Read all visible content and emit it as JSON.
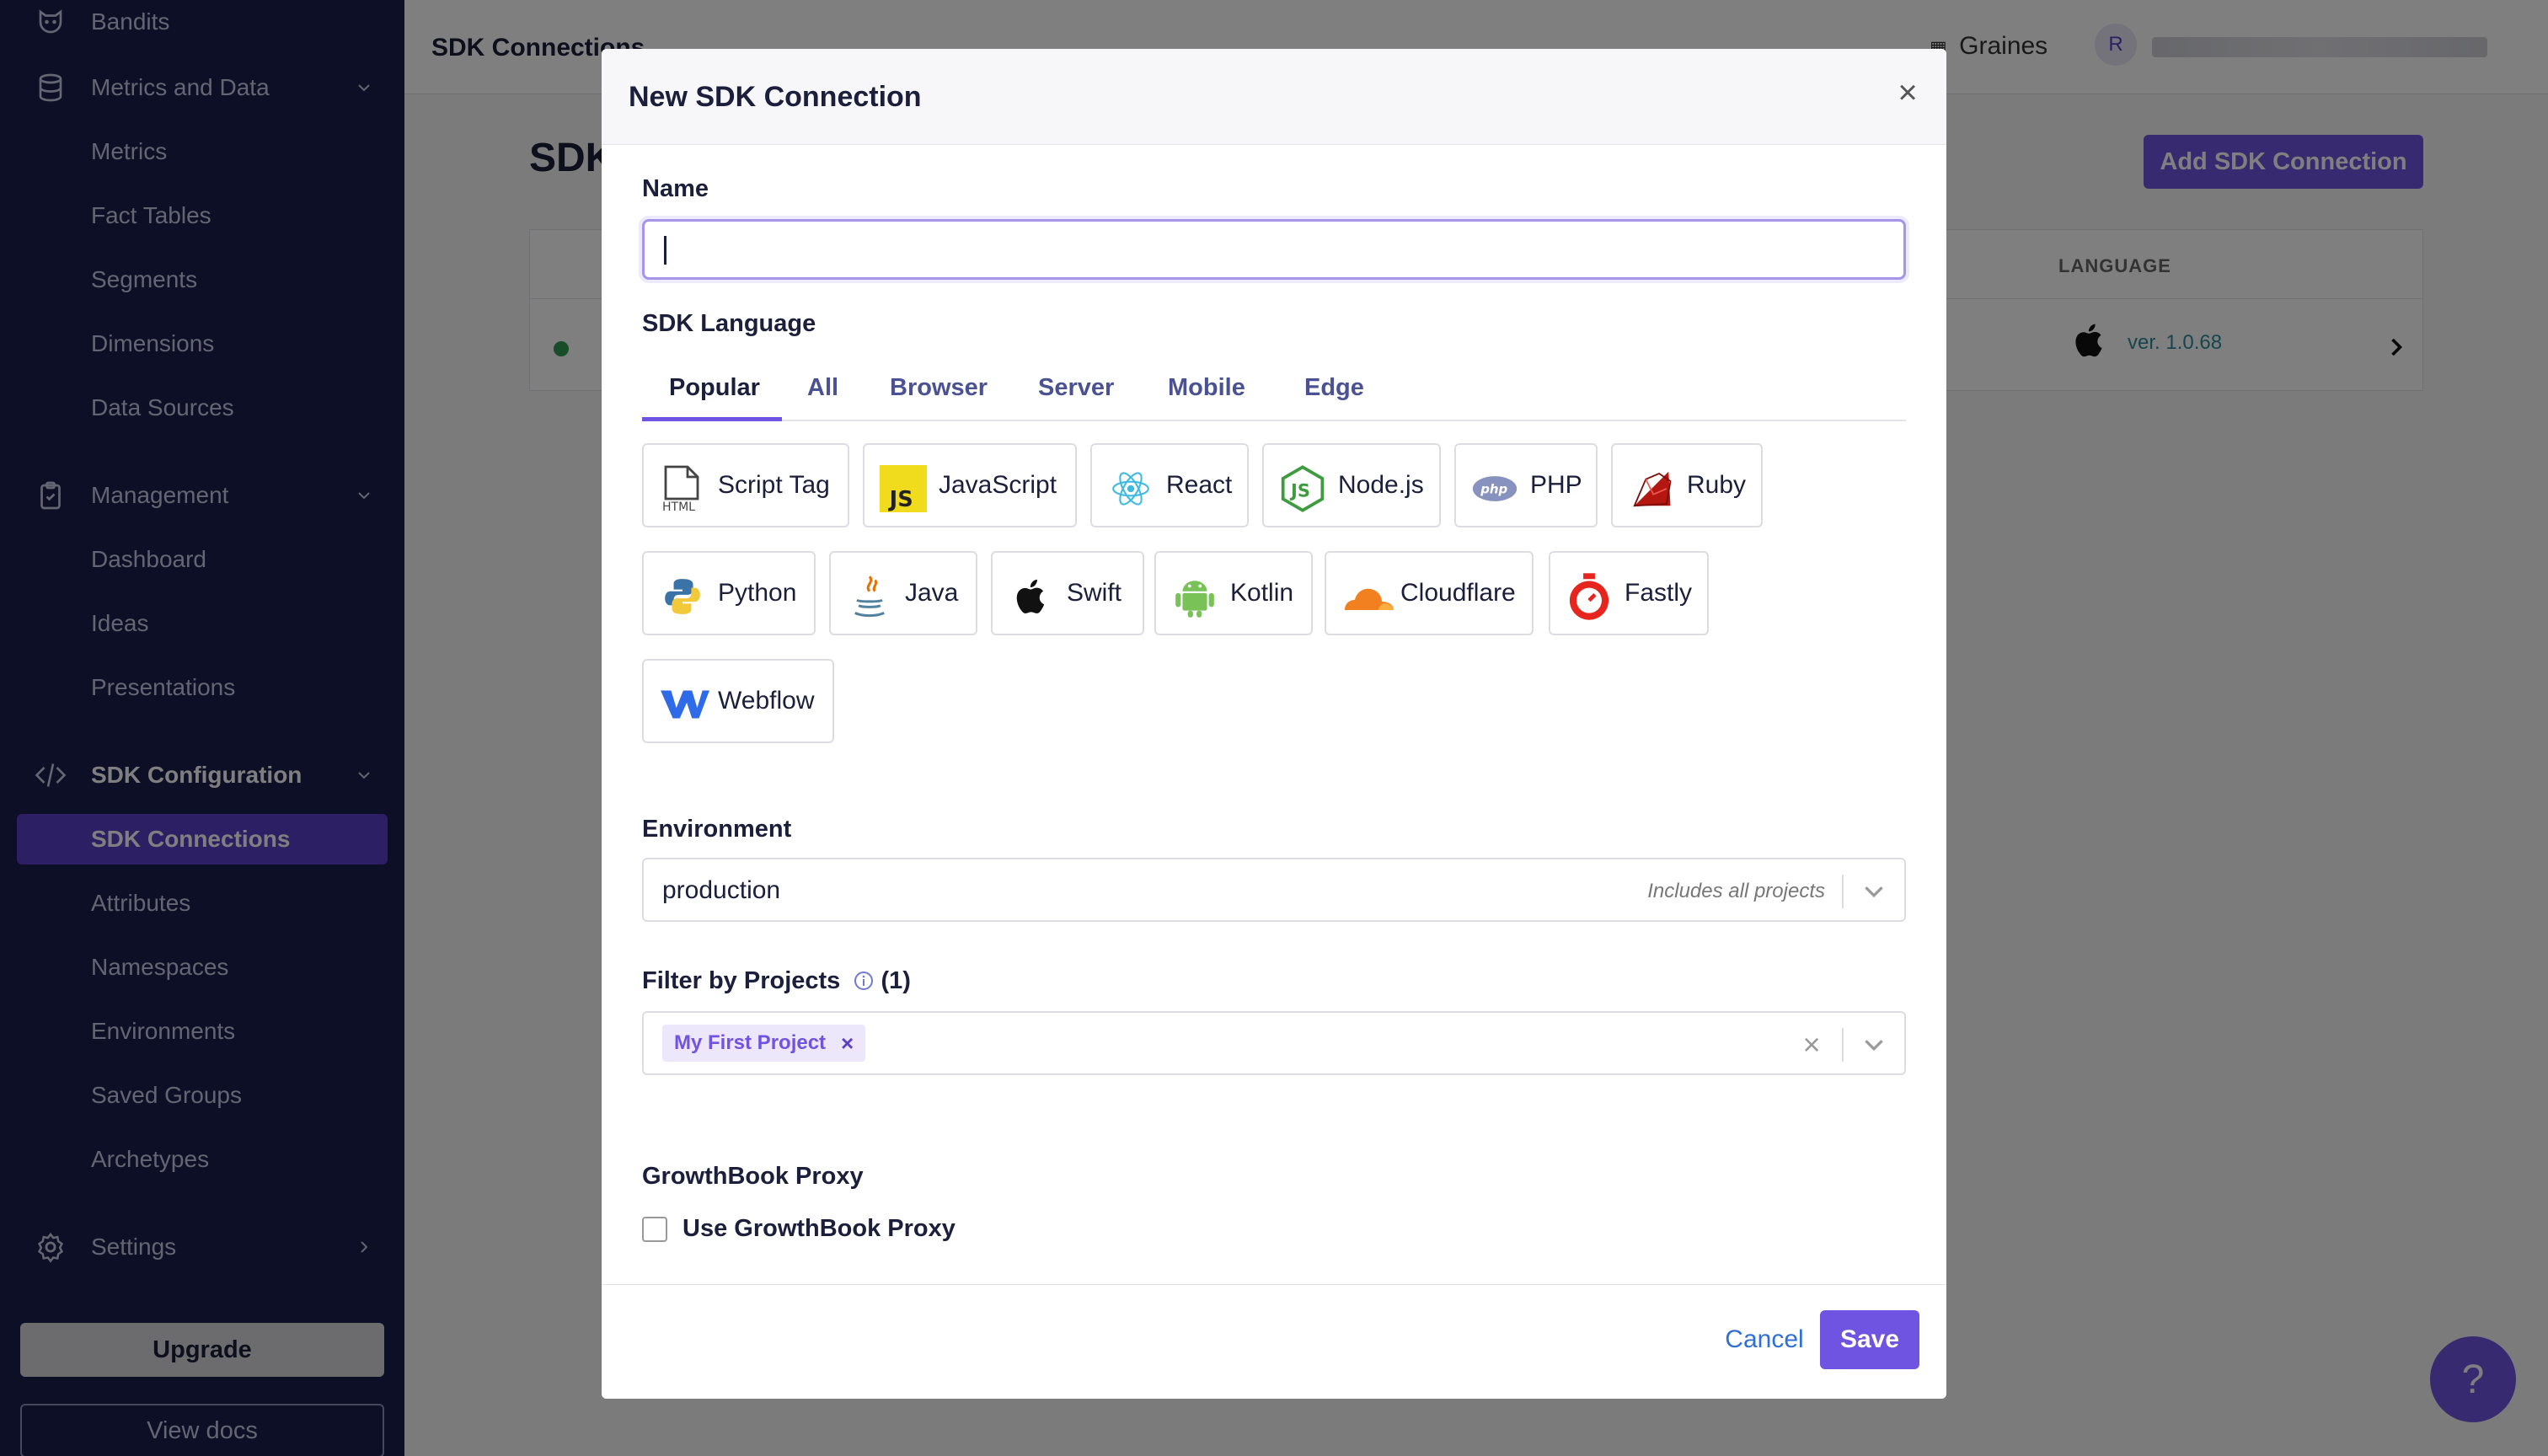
{
  "sidebar": {
    "items": [
      {
        "label": "Bandits",
        "icon": "raccoon-icon"
      },
      {
        "label": "Metrics and Data",
        "icon": "database-icon"
      },
      {
        "label": "Metrics"
      },
      {
        "label": "Fact Tables"
      },
      {
        "label": "Segments"
      },
      {
        "label": "Dimensions"
      },
      {
        "label": "Data Sources"
      },
      {
        "label": "Management",
        "icon": "clipboard-icon"
      },
      {
        "label": "Dashboard"
      },
      {
        "label": "Ideas"
      },
      {
        "label": "Presentations"
      },
      {
        "label": "SDK Configuration",
        "icon": "code-icon"
      },
      {
        "label": "SDK Connections"
      },
      {
        "label": "Attributes"
      },
      {
        "label": "Namespaces"
      },
      {
        "label": "Environments"
      },
      {
        "label": "Saved Groups"
      },
      {
        "label": "Archetypes"
      },
      {
        "label": "Settings",
        "icon": "gear-icon"
      }
    ],
    "upgrade_label": "Upgrade",
    "docs_label": "View docs"
  },
  "header": {
    "title": "SDK Connections",
    "org": "Graines",
    "avatar_initial": "R"
  },
  "page": {
    "heading": "SDK",
    "add_button": "Add SDK Connection",
    "table_header_language": "LANGUAGE",
    "row_version": "ver. 1.0.68"
  },
  "help_label": "?",
  "modal": {
    "title": "New SDK Connection",
    "close_symbol": "×",
    "name_label": "Name",
    "name_value": "",
    "sdk_language_label": "SDK Language",
    "tabs": [
      "Popular",
      "All",
      "Browser",
      "Server",
      "Mobile",
      "Edge"
    ],
    "active_tab": "Popular",
    "sdks": [
      {
        "name": "Script Tag",
        "icon": "html-file-icon"
      },
      {
        "name": "JavaScript",
        "icon": "javascript-icon"
      },
      {
        "name": "React",
        "icon": "react-icon"
      },
      {
        "name": "Node.js",
        "icon": "nodejs-icon"
      },
      {
        "name": "PHP",
        "icon": "php-icon"
      },
      {
        "name": "Ruby",
        "icon": "ruby-icon"
      },
      {
        "name": "Python",
        "icon": "python-icon"
      },
      {
        "name": "Java",
        "icon": "java-icon"
      },
      {
        "name": "Swift",
        "icon": "apple-icon"
      },
      {
        "name": "Kotlin",
        "icon": "android-icon"
      },
      {
        "name": "Cloudflare",
        "icon": "cloudflare-icon"
      },
      {
        "name": "Fastly",
        "icon": "fastly-icon"
      },
      {
        "name": "Webflow",
        "icon": "webflow-icon"
      }
    ],
    "environment_label": "Environment",
    "environment_value": "production",
    "environment_hint": "Includes all projects",
    "filter_projects_label": "Filter by Projects",
    "filter_projects_count": "(1)",
    "project_tag": "My First Project",
    "project_tag_remove": "×",
    "clear_symbol": "×",
    "proxy_section_label": "GrowthBook Proxy",
    "proxy_checkbox_label": "Use GrowthBook Proxy",
    "proxy_checked": false,
    "cancel_label": "Cancel",
    "save_label": "Save"
  },
  "colors": {
    "sidebar_bg": "#1b1f4d",
    "accent": "#6e54e0",
    "active_nav": "#5b3fc9",
    "link": "#2f6fd6"
  }
}
